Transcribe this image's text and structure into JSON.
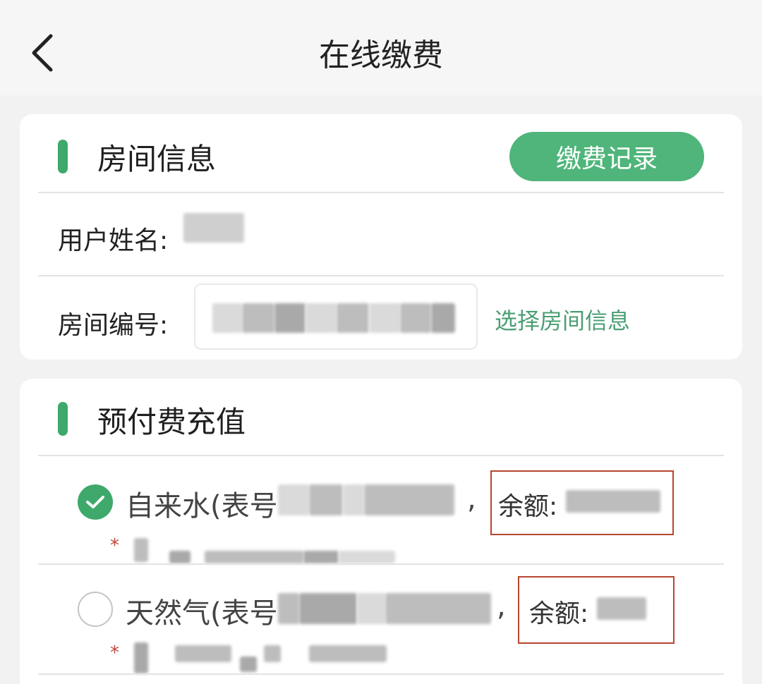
{
  "nav": {
    "title": "在线缴费",
    "back_icon": "chevron-left-icon"
  },
  "room_info": {
    "title": "房间信息",
    "record_button": "缴费记录",
    "user_name_label": "用户姓名:",
    "room_number_label": "房间编号:",
    "select_room_link": "选择房间信息"
  },
  "prepay": {
    "title": "预付费充值",
    "items": [
      {
        "label": "自来水(表号",
        "separator": ",",
        "balance_label": "余额:",
        "selected": true,
        "note_mark": "*"
      },
      {
        "label": "天然气(表号",
        "separator": ",",
        "balance_label": "余额:",
        "selected": false,
        "note_mark": "*"
      }
    ]
  },
  "colors": {
    "accent_green": "#3ea96b",
    "button_green": "#4fb57a",
    "link_green": "#4a9e72",
    "highlight_red": "#b7452f"
  }
}
